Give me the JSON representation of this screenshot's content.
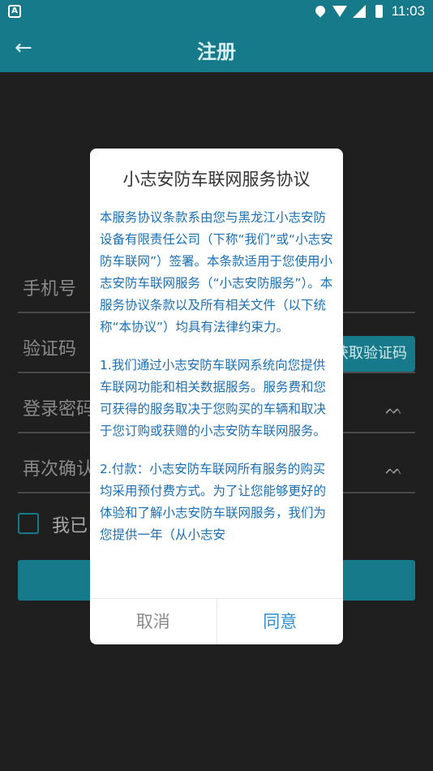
{
  "status_bar": {
    "left_badge": "A",
    "time": "11:03",
    "icons": [
      "location-icon",
      "wifi-icon",
      "signal-icon",
      "battery-icon"
    ]
  },
  "app_bar": {
    "back_icon": "←",
    "title": "注册"
  },
  "form": {
    "phone_placeholder": "手机号",
    "code_placeholder": "验证码",
    "get_code_label": "获取验证码",
    "password_placeholder": "登录密码",
    "confirm_password_placeholder": "再次确认",
    "eye_glyph": "ᨓ",
    "agree_label": "我已"
  },
  "dialog": {
    "title": "小志安防车联网服务协议",
    "paragraphs": [
      "本服务协议条款系由您与黑龙江小志安防设备有限责任公司（下称“我们”或“小志安防车联网”）签署。本条款适用于您使用小志安防车联网服务（“小志安防服务”）。本服务协议条款以及所有相关文件（以下统称“本协议”）均具有法律约束力。",
      "1.我们通过小志安防车联网系统向您提供车联网功能和相关数据服务。服务费和您可获得的服务取决于您购买的车辆和取决于您订购或获赠的小志安防车联网服务。",
      "2.付款：小志安防车联网所有服务的购买均采用预付费方式。为了让您能够更好的体验和了解小志安防车联网服务，我们为您提供一年（从小志安"
    ],
    "cancel_label": "取消",
    "agree_label": "同意"
  },
  "colors": {
    "primary": "#167a8a",
    "dialog_text": "#1b6fb3",
    "confirm_text": "#2e8fd3"
  }
}
